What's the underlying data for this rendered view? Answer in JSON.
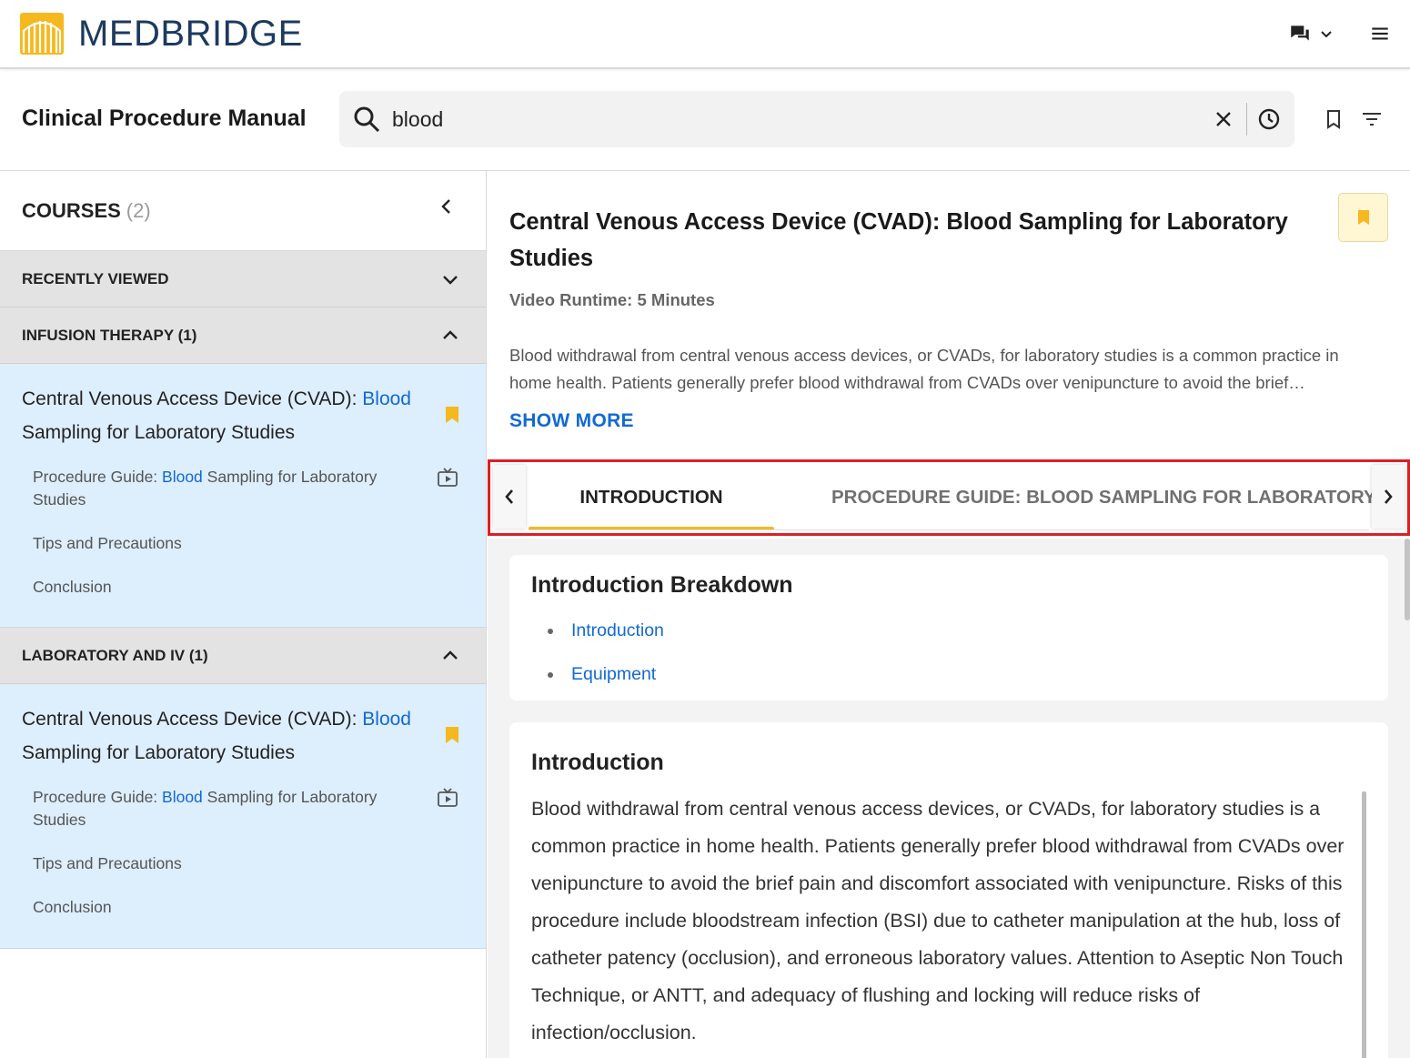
{
  "app": {
    "brand": "MEDBRIDGE"
  },
  "header": {
    "title": "Clinical Procedure Manual"
  },
  "search": {
    "value": "blood",
    "placeholder": ""
  },
  "sidebar": {
    "courses_label": "COURSES",
    "courses_count": "(2)",
    "sections": [
      {
        "label": "RECENTLY VIEWED",
        "expanded": false
      },
      {
        "label": "INFUSION THERAPY (1)",
        "expanded": true,
        "course": {
          "title_prefix": "Central Venous Access Device (CVAD): ",
          "title_highlight": "Blood",
          "title_suffix": " Sampling for Laboratory Studies",
          "items": [
            {
              "prefix": "Procedure Guide: ",
              "highlight": "Blood",
              "suffix": " Sampling for Laboratory Studies",
              "has_video": true
            },
            {
              "label": "Tips and Precautions"
            },
            {
              "label": "Conclusion"
            }
          ]
        }
      },
      {
        "label": "LABORATORY AND IV (1)",
        "expanded": true,
        "course": {
          "title_prefix": "Central Venous Access Device (CVAD): ",
          "title_highlight": "Blood",
          "title_suffix": " Sampling for Laboratory Studies",
          "items": [
            {
              "prefix": "Procedure Guide: ",
              "highlight": "Blood",
              "suffix": " Sampling for Laboratory Studies",
              "has_video": true
            },
            {
              "label": "Tips and Precautions"
            },
            {
              "label": "Conclusion"
            }
          ]
        }
      }
    ]
  },
  "main": {
    "title": "Central Venous Access Device (CVAD): Blood Sampling for Laboratory Studies",
    "runtime": "Video Runtime: 5 Minutes",
    "description": "Blood withdrawal from central venous access devices, or CVADs, for laboratory studies is a common practice in home health. Patients generally prefer blood withdrawal from CVADs over venipuncture to avoid the brief…",
    "show_more": "SHOW MORE",
    "tabs": [
      {
        "label": "INTRODUCTION",
        "active": true
      },
      {
        "label": "PROCEDURE GUIDE: BLOOD SAMPLING FOR LABORATORY STUDIES",
        "active": false
      }
    ],
    "breakdown": {
      "title": "Introduction Breakdown",
      "links": [
        "Introduction",
        "Equipment"
      ]
    },
    "intro": {
      "title": "Introduction",
      "text": "Blood withdrawal from central venous access devices, or CVADs, for laboratory studies is a common practice in home health. Patients generally prefer blood withdrawal from CVADs over venipuncture to avoid the brief pain and discomfort associated with venipuncture. Risks of this procedure include bloodstream infection (BSI) due to catheter manipulation at the hub, loss of catheter patency (occlusion), and erroneous laboratory values. Attention to Aseptic Non Touch Technique, or ANTT, and adequacy of flushing and locking will reduce risks of infection/occlusion."
    }
  },
  "icons": {
    "logo": "medbridge-logo-icon",
    "chat": "chat-icon",
    "menu": "hamburger-menu-icon",
    "search": "search-icon",
    "clear": "close-icon",
    "history": "history-clock-icon",
    "bookmark": "bookmark-icon",
    "filter": "filter-icon",
    "video": "video-icon"
  },
  "colors": {
    "brand": "#1d3a5f",
    "accent_yellow": "#f5b81f",
    "link_blue": "#1269d3",
    "highlight_bg": "#ddeefd",
    "section_bg": "#e3e3e3",
    "focus_outline": "#d92027"
  }
}
